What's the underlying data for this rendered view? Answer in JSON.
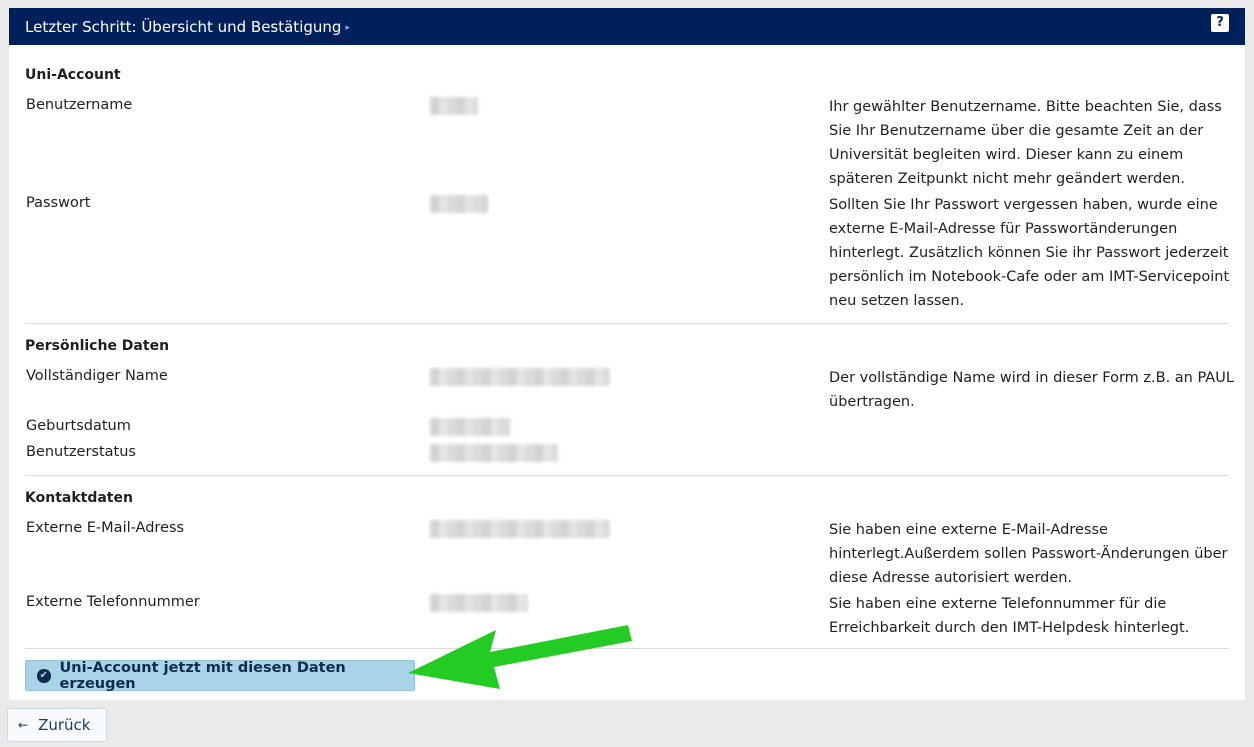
{
  "header": {
    "title": "Letzter Schritt: Übersicht und Bestätigung",
    "caret": "▸",
    "help": "?"
  },
  "sections": {
    "account": {
      "title": "Uni-Account",
      "username_label": "Benutzername",
      "username_hint": "Ihr gewählter Benutzername. Bitte beachten Sie, dass Sie Ihr Benutzername über die gesamte Zeit an der Universität begleiten wird. Dieser kann zu einem späteren Zeitpunkt nicht mehr geändert werden.",
      "password_label": "Passwort",
      "password_hint": "Sollten Sie Ihr Passwort vergessen haben, wurde eine externe E-Mail-Adresse für Passwortänderungen hinterlegt. Zusätzlich können Sie ihr Passwort jederzeit persönlich im Notebook-Cafe oder am IMT-Servicepoint neu setzen lassen."
    },
    "personal": {
      "title": "Persönliche Daten",
      "fullname_label": "Vollständiger Name",
      "fullname_hint": "Der vollständige Name wird in dieser Form z.B. an PAUL übertragen.",
      "birthdate_label": "Geburtsdatum",
      "status_label": "Benutzerstatus"
    },
    "contact": {
      "title": "Kontaktdaten",
      "email_label": "Externe E-Mail-Adress",
      "email_hint": "Sie haben eine externe E-Mail-Adresse hinterlegt.Außerdem sollen Passwort-Änderungen über diese Adresse autorisiert werden.",
      "phone_label": "Externe Telefonnummer",
      "phone_hint": "Sie haben eine externe Telefonnummer für die Erreichbarkeit durch den IMT-Helpdesk hinterlegt."
    }
  },
  "actions": {
    "submit_label": "Uni-Account jetzt mit diesen Daten erzeugen",
    "back_label": "Zurück"
  },
  "colors": {
    "header_bg": "#00205b",
    "submit_bg": "#a9d3e6",
    "annotation_arrow": "#22cc22"
  },
  "icons": {
    "submit": "check-circle-icon",
    "back": "arrow-left-icon",
    "help": "help-icon"
  }
}
